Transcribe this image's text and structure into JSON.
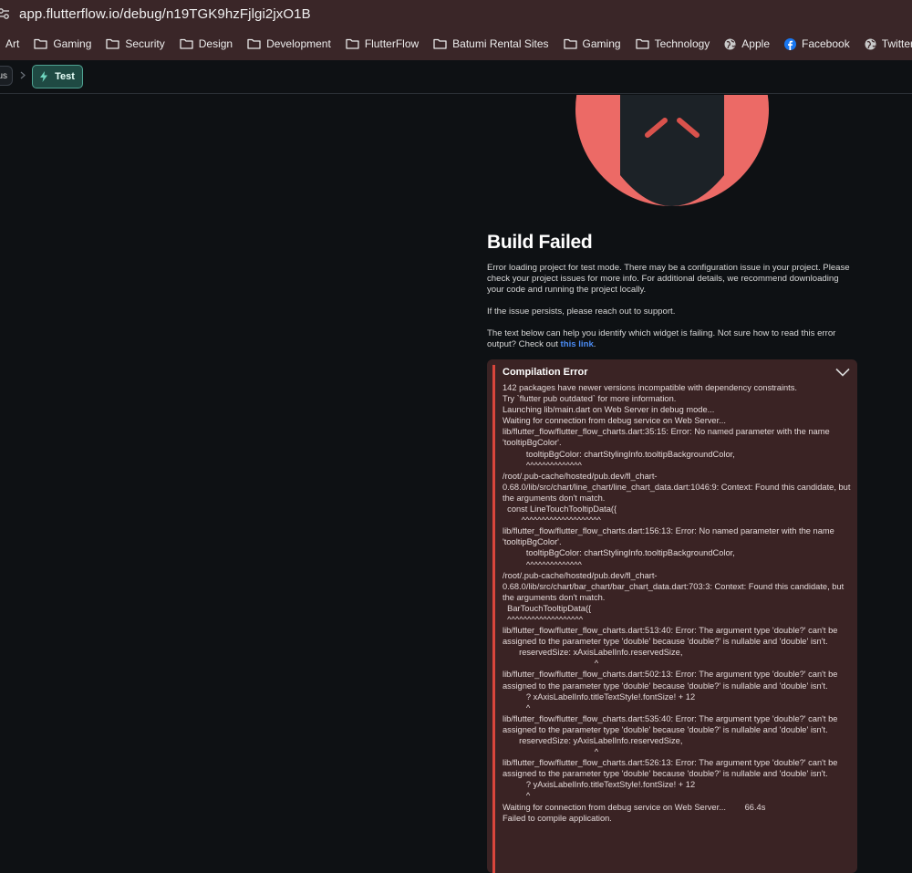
{
  "browser": {
    "url": "app.flutterflow.io/debug/n19TGK9hzFjlgi2jxO1B",
    "bookmarks": [
      {
        "label": "Art",
        "icon": "none"
      },
      {
        "label": "Gaming",
        "icon": "folder-icon"
      },
      {
        "label": "Security",
        "icon": "folder-icon"
      },
      {
        "label": "Design",
        "icon": "folder-icon"
      },
      {
        "label": "Development",
        "icon": "folder-icon"
      },
      {
        "label": "FlutterFlow",
        "icon": "folder-icon"
      },
      {
        "label": "Batumi Rental Sites",
        "icon": "folder-icon"
      },
      {
        "label": "Gaming",
        "icon": "folder-icon"
      },
      {
        "label": "Technology",
        "icon": "folder-icon"
      },
      {
        "label": "Apple",
        "icon": "globe-icon"
      },
      {
        "label": "Facebook",
        "icon": "facebook-icon"
      },
      {
        "label": "Twitter",
        "icon": "globe-icon"
      }
    ]
  },
  "toolbar": {
    "prev_chip": "us",
    "active_chip": "Test"
  },
  "colors": {
    "accent_teal": "#4fa392",
    "error_red": "#d9463c",
    "illustration_red": "#ec6a66"
  },
  "main": {
    "title": "Build Failed",
    "para1": "Error loading project for test mode. There may be a configuration issue in your project. Please check your project issues for more info. For additional details, we recommend downloading your code and running the project locally.",
    "para2": "If the issue persists, please reach out to support.",
    "para3_prefix": "The text below can help you identify which widget is failing. Not sure how to read this error output? Check out ",
    "para3_link": "this link",
    "para3_suffix": "."
  },
  "error": {
    "heading": "Compilation Error",
    "log": "142 packages have newer versions incompatible with dependency constraints.\nTry `flutter pub outdated` for more information.\nLaunching lib/main.dart on Web Server in debug mode...\nWaiting for connection from debug service on Web Server...\nlib/flutter_flow/flutter_flow_charts.dart:35:15: Error: No named parameter with the name 'tooltipBgColor'.\n          tooltipBgColor: chartStylingInfo.tooltipBackgroundColor,\n          ^^^^^^^^^^^^^^\n/root/.pub-cache/hosted/pub.dev/fl_chart-0.68.0/lib/src/chart/line_chart/line_chart_data.dart:1046:9: Context: Found this candidate, but the arguments don't match.\n  const LineTouchTooltipData({\n        ^^^^^^^^^^^^^^^^^^^^\nlib/flutter_flow/flutter_flow_charts.dart:156:13: Error: No named parameter with the name 'tooltipBgColor'.\n          tooltipBgColor: chartStylingInfo.tooltipBackgroundColor,\n          ^^^^^^^^^^^^^^\n/root/.pub-cache/hosted/pub.dev/fl_chart-0.68.0/lib/src/chart/bar_chart/bar_chart_data.dart:703:3: Context: Found this candidate, but the arguments don't match.\n  BarTouchTooltipData({\n  ^^^^^^^^^^^^^^^^^^^\nlib/flutter_flow/flutter_flow_charts.dart:513:40: Error: The argument type 'double?' can't be assigned to the parameter type 'double' because 'double?' is nullable and 'double' isn't.\n       reservedSize: xAxisLabelInfo.reservedSize,\n                                       ^\nlib/flutter_flow/flutter_flow_charts.dart:502:13: Error: The argument type 'double?' can't be assigned to the parameter type 'double' because 'double?' is nullable and 'double' isn't.\n          ? xAxisLabelInfo.titleTextStyle!.fontSize! + 12\n          ^\nlib/flutter_flow/flutter_flow_charts.dart:535:40: Error: The argument type 'double?' can't be assigned to the parameter type 'double' because 'double?' is nullable and 'double' isn't.\n       reservedSize: yAxisLabelInfo.reservedSize,\n                                       ^\nlib/flutter_flow/flutter_flow_charts.dart:526:13: Error: The argument type 'double?' can't be assigned to the parameter type 'double' because 'double?' is nullable and 'double' isn't.\n          ? yAxisLabelInfo.titleTextStyle!.fontSize! + 12\n          ^\nWaiting for connection from debug service on Web Server...        66.4s\nFailed to compile application."
  }
}
